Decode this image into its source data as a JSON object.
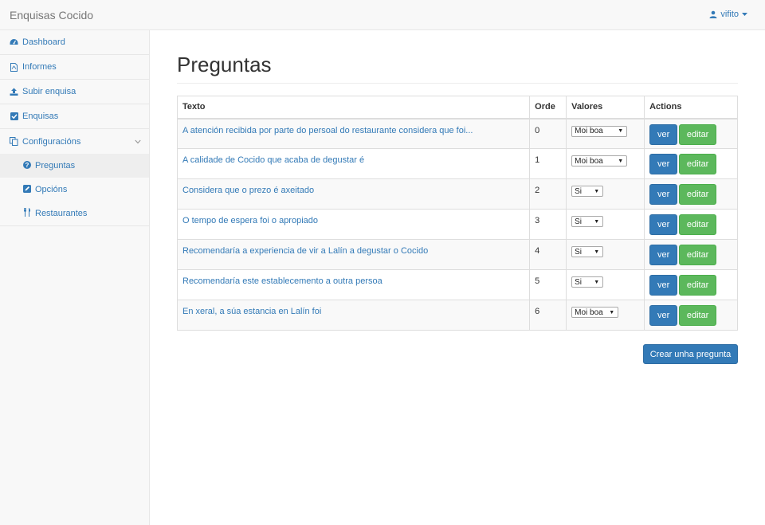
{
  "navbar": {
    "brand": "Enquisas Cocido",
    "user": "vifito"
  },
  "sidebar": {
    "items": [
      {
        "label": "Dashboard",
        "icon": "dashboard-icon"
      },
      {
        "label": "Informes",
        "icon": "file-pdf-icon"
      },
      {
        "label": "Subir enquisa",
        "icon": "upload-icon"
      },
      {
        "label": "Enquisas",
        "icon": "checkbox-icon"
      },
      {
        "label": "Configuracións",
        "icon": "copy-icon"
      }
    ],
    "subitems": [
      {
        "label": "Preguntas",
        "icon": "question-circle-icon",
        "active": true
      },
      {
        "label": "Opcións",
        "icon": "edit-icon"
      },
      {
        "label": "Restaurantes",
        "icon": "cutlery-icon"
      }
    ]
  },
  "main": {
    "title": "Preguntas",
    "table": {
      "headers": [
        "Texto",
        "Orde",
        "Valores",
        "Actions"
      ],
      "rows": [
        {
          "texto": "A atención recibida por parte do persoal do restaurante considera que foi...",
          "orde": "0",
          "valor": "Moi boa"
        },
        {
          "texto": "A calidade de Cocido que acaba de degustar é",
          "orde": "1",
          "valor": "Moi boa"
        },
        {
          "texto": "Considera que o prezo é axeitado",
          "orde": "2",
          "valor": "Si"
        },
        {
          "texto": "O tempo de espera foi o apropiado",
          "orde": "3",
          "valor": "Si"
        },
        {
          "texto": "Recomendaría a experiencia de vir a Lalín a degustar o Cocido",
          "orde": "4",
          "valor": "Si"
        },
        {
          "texto": "Recomendaría este establecemento a outra persoa",
          "orde": "5",
          "valor": "Si"
        },
        {
          "texto": "En xeral, a súa estancia en Lalín foi",
          "orde": "6",
          "valor": "Moi boa"
        }
      ],
      "ver_label": "ver",
      "editar_label": "editar"
    },
    "create_label": "Crear unha pregunta"
  },
  "colors": {
    "primary": "#337ab7",
    "success": "#5cb85c",
    "navbar_bg": "#f8f8f8"
  }
}
